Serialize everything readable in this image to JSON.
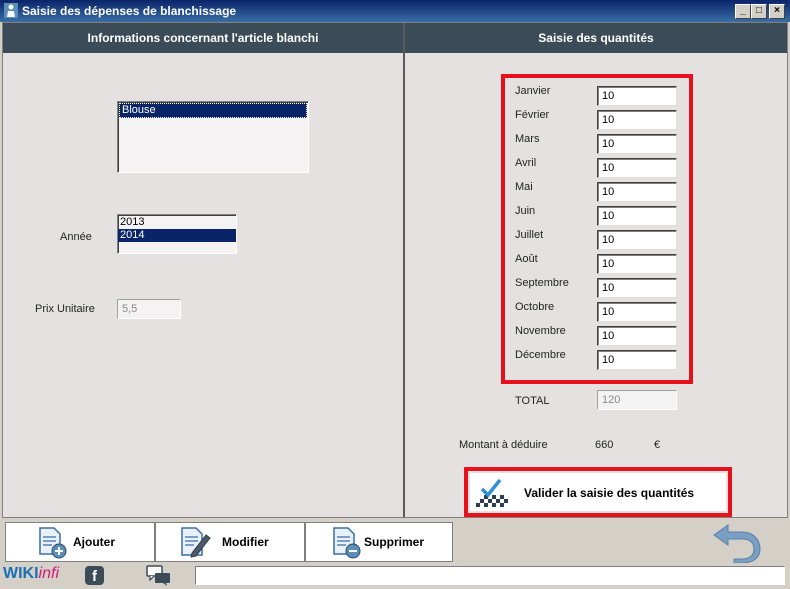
{
  "window": {
    "title": "Saisie des dépenses de blanchissage",
    "buttons": {
      "minimize": "_",
      "maximize": "□",
      "close": "×"
    }
  },
  "left_panel": {
    "header": "Informations concernant l'article blanchi",
    "article_list": [
      {
        "label": "Blouse",
        "selected": true
      }
    ],
    "year_label": "Année",
    "year_list": [
      {
        "label": "2013",
        "selected": false
      },
      {
        "label": "2014",
        "selected": true
      }
    ],
    "price_label": "Prix Unitaire",
    "price_value": "5,5"
  },
  "right_panel": {
    "header": "Saisie des quantités",
    "months": [
      {
        "label": "Janvier",
        "value": "10"
      },
      {
        "label": "Février",
        "value": "10"
      },
      {
        "label": "Mars",
        "value": "10"
      },
      {
        "label": "Avril",
        "value": "10"
      },
      {
        "label": "Mai",
        "value": "10"
      },
      {
        "label": "Juin",
        "value": "10"
      },
      {
        "label": "Juillet",
        "value": "10"
      },
      {
        "label": "Août",
        "value": "10"
      },
      {
        "label": "Septembre",
        "value": "10"
      },
      {
        "label": "Octobre",
        "value": "10"
      },
      {
        "label": "Novembre",
        "value": "10"
      },
      {
        "label": "Décembre",
        "value": "10"
      }
    ],
    "total_label": "TOTAL",
    "total_value": "120",
    "deduct_label": "Montant à déduire",
    "deduct_value": "660",
    "currency": "€",
    "validate_button": "Valider la saisie des quantités"
  },
  "toolbar": {
    "add": "Ajouter",
    "modify": "Modifier",
    "delete": "Supprimer"
  },
  "footer": {
    "brand_wiki": "WIKI",
    "brand_infi": "infi",
    "facebook_icon": "f"
  },
  "colors": {
    "header_bg": "#3b4c58",
    "highlight_red": "#e8101a",
    "selection": "#0a246a",
    "brand_pink": "#d4187c",
    "brand_blue": "#1a6fb5"
  }
}
